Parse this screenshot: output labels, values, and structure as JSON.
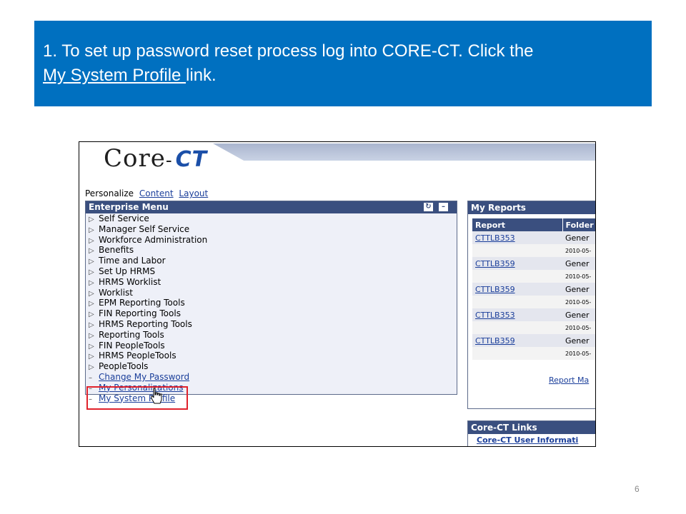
{
  "slide": {
    "instruction_prefix": "1. To set up password reset process log into CORE-CT. Click the",
    "instruction_link": "My System Profile ",
    "instruction_suffix": "link.",
    "page_number": "6"
  },
  "portal": {
    "logo_core": "Core",
    "logo_dash": "-",
    "logo_ct": "CT",
    "personalize": {
      "label": "Personalize",
      "content_link": "Content",
      "layout_link": "Layout"
    },
    "enterprise_menu": {
      "title": "Enterprise Menu",
      "items": [
        {
          "label": "Self Service",
          "type": "folder"
        },
        {
          "label": "Manager Self Service",
          "type": "folder"
        },
        {
          "label": "Workforce Administration",
          "type": "folder"
        },
        {
          "label": "Benefits",
          "type": "folder"
        },
        {
          "label": "Time and Labor",
          "type": "folder"
        },
        {
          "label": "Set Up HRMS",
          "type": "folder"
        },
        {
          "label": "HRMS Worklist",
          "type": "folder"
        },
        {
          "label": "Worklist",
          "type": "folder"
        },
        {
          "label": "EPM Reporting Tools",
          "type": "folder"
        },
        {
          "label": "FIN Reporting Tools",
          "type": "folder"
        },
        {
          "label": "HRMS Reporting Tools",
          "type": "folder"
        },
        {
          "label": "Reporting Tools",
          "type": "folder"
        },
        {
          "label": "FIN PeopleTools",
          "type": "folder"
        },
        {
          "label": "HRMS PeopleTools",
          "type": "folder"
        },
        {
          "label": "PeopleTools",
          "type": "folder"
        },
        {
          "label": "Change My Password",
          "type": "link"
        },
        {
          "label": "My Personalizations",
          "type": "link"
        },
        {
          "label": "My System Profile",
          "type": "link"
        }
      ]
    },
    "my_reports": {
      "title": "My Reports",
      "columns": [
        "Report",
        "Folder"
      ],
      "rows": [
        {
          "report": "CTTLB353",
          "folder": "Gener",
          "date": "2010-05-"
        },
        {
          "report": "CTTLB359",
          "folder": "Gener",
          "date": "2010-05-"
        },
        {
          "report": "CTTLB359",
          "folder": "Gener",
          "date": "2010-05-"
        },
        {
          "report": "CTTLB353",
          "folder": "Gener",
          "date": "2010-05-"
        },
        {
          "report": "CTTLB359",
          "folder": "Gener",
          "date": "2010-05-"
        }
      ],
      "footer_link": "Report Ma"
    },
    "core_ct_links": {
      "title": "Core-CT Links",
      "first_link": "Core-CT User Informati"
    }
  },
  "colors": {
    "banner": "#0070c0",
    "panel_header": "#3a4f7f",
    "link": "#1a3e9a",
    "highlight": "#e0222c"
  }
}
